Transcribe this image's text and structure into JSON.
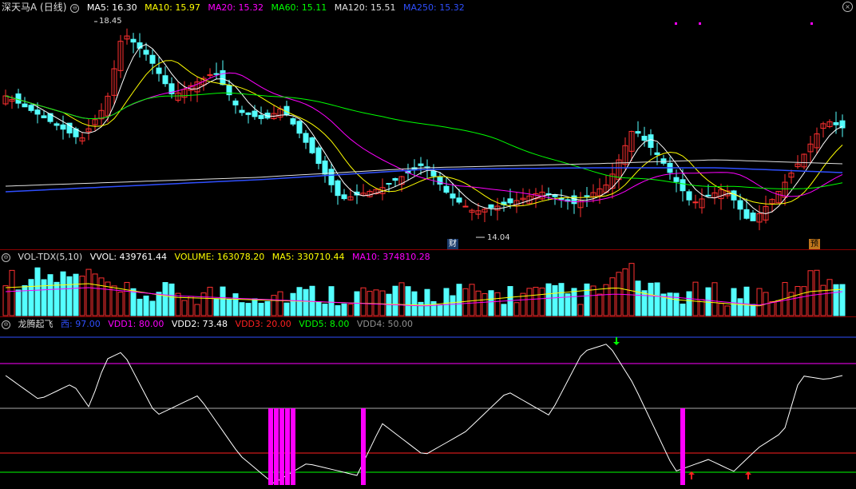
{
  "app": {
    "stock_title": "深天马A (日线)"
  },
  "ma_panel": {
    "items": [
      {
        "label": "MA5: 16.30",
        "color": "#ffffff"
      },
      {
        "label": "MA10: 15.97",
        "color": "#ffff00"
      },
      {
        "label": "MA20: 15.32",
        "color": "#ff00ff"
      },
      {
        "label": "MA60: 15.11",
        "color": "#00ff00"
      },
      {
        "label": "MA120: 15.51",
        "color": "#e0e0e0"
      },
      {
        "label": "MA250: 15.32",
        "color": "#2f4fff"
      }
    ],
    "high_label": "18.45",
    "low_label": "14.04",
    "tag_cai": "财",
    "tag_yu": "预"
  },
  "vol_panel": {
    "title": "VOL-TDX(5,10)",
    "items": [
      {
        "label": "VVOL: 439761.44",
        "color": "#ffffff"
      },
      {
        "label": "VOLUME: 163078.20",
        "color": "#ffff00"
      },
      {
        "label": "MA5: 330710.44",
        "color": "#ffff00"
      },
      {
        "label": "MA10: 374810.28",
        "color": "#ff00ff"
      }
    ]
  },
  "ind_panel": {
    "title": "龙腾起飞",
    "items": [
      {
        "label": "西: 97.00",
        "color": "#2f4fff"
      },
      {
        "label": "VDD1: 80.00",
        "color": "#ff00ff"
      },
      {
        "label": "VDD2: 73.48",
        "color": "#ffffff"
      },
      {
        "label": "VDD3: 20.00",
        "color": "#ff2020"
      },
      {
        "label": "VDD5: 8.00",
        "color": "#00ff00"
      },
      {
        "label": "VDD4: 50.00",
        "color": "#909090"
      }
    ]
  },
  "colors": {
    "up": "#ff3030",
    "down": "#54ffff",
    "bg": "#000000",
    "grid": "#8b0000"
  }
}
